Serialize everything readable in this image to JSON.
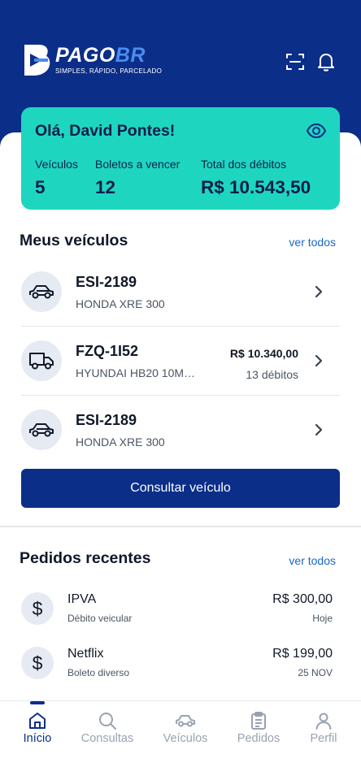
{
  "brand": {
    "name_main": "PAGO",
    "name_accent": "BR",
    "tagline": "SIMPLES, RÁPIDO, PARCELADO"
  },
  "header": {
    "scan_icon": "scan-icon",
    "bell_icon": "bell-icon"
  },
  "summary": {
    "greeting": "Olá, David Pontes!",
    "eye_icon": "eye-icon",
    "vehicles_label": "Veículos",
    "vehicles_value": "5",
    "bills_label": "Boletos a vencer",
    "bills_value": "12",
    "total_label": "Total dos débitos",
    "total_value": "R$ 10.543,50"
  },
  "vehicles": {
    "title": "Meus veículos",
    "see_all": "ver todos",
    "items": [
      {
        "plate": "ESI-2189",
        "model": "HONDA XRE 300",
        "amount": "",
        "count": "",
        "icon": "car-icon"
      },
      {
        "plate": "FZQ-1I52",
        "model": "HYUNDAI HB20 10M…",
        "amount": "R$ 10.340,00",
        "count": "13 débitos",
        "icon": "truck-icon"
      },
      {
        "plate": "ESI-2189",
        "model": "HONDA XRE 300",
        "amount": "",
        "count": "",
        "icon": "car-icon"
      }
    ],
    "button": "Consultar veículo"
  },
  "orders": {
    "title": "Pedidos recentes",
    "see_all": "ver todos",
    "items": [
      {
        "symbol": "$",
        "name": "IPVA",
        "type": "Débito veicular",
        "price": "R$ 300,00",
        "date": "Hoje"
      },
      {
        "symbol": "$",
        "name": "Netflix",
        "type": "Boleto diverso",
        "price": "R$ 199,00",
        "date": "25 NOV"
      }
    ]
  },
  "tabs": [
    {
      "label": "Início",
      "icon": "home-icon",
      "active": true
    },
    {
      "label": "Consultas",
      "icon": "search-icon",
      "active": false
    },
    {
      "label": "Veículos",
      "icon": "car-icon",
      "active": false
    },
    {
      "label": "Pedidos",
      "icon": "clipboard-icon",
      "active": false
    },
    {
      "label": "Perfil",
      "icon": "user-icon",
      "active": false
    }
  ],
  "colors": {
    "primary": "#0b2e88",
    "teal": "#1ed6c0",
    "link": "#1a66c4",
    "inactive": "#9aa2b1"
  }
}
